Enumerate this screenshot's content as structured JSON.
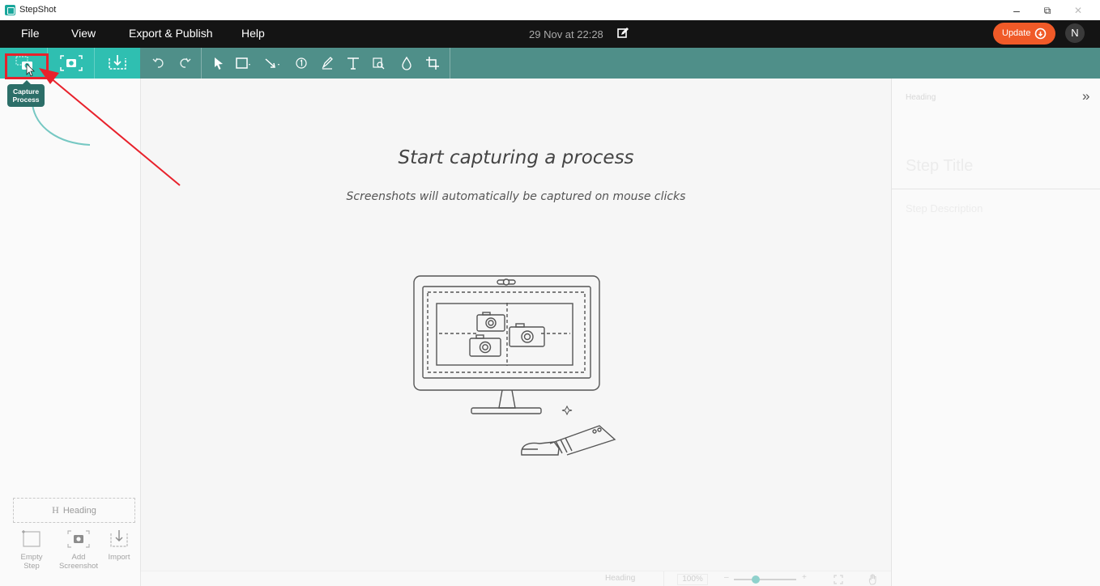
{
  "window": {
    "app_name": "StepShot",
    "controls": {
      "minimize": "–",
      "restore": "⧉",
      "close": "✕"
    }
  },
  "menu": {
    "items": [
      "File",
      "View",
      "Export & Publish",
      "Help"
    ],
    "document_date": "29 Nov at 22:28",
    "update_label": "Update",
    "user_initial": "N"
  },
  "toolbar": {
    "capture_buttons": [
      "capture-process-icon",
      "add-screenshot-icon",
      "import-icon"
    ],
    "tools": [
      "undo-icon",
      "redo-icon",
      "select-icon",
      "rectangle-icon",
      "arrow-icon",
      "number-icon",
      "pen-icon",
      "text-icon",
      "magnify-icon",
      "blur-icon",
      "crop-icon"
    ]
  },
  "tooltip": {
    "line1": "Capture",
    "line2": "Process"
  },
  "left_panel": {
    "heading_glyph": "H",
    "heading_label": "Heading",
    "empty_step": {
      "line1": "Empty",
      "line2": "Step"
    },
    "add_screenshot": {
      "line1": "Add",
      "line2": "Screenshot"
    },
    "import": {
      "line1": "Import"
    }
  },
  "canvas": {
    "title": "Start capturing a process",
    "subtitle": "Screenshots will automatically be captured on mouse clicks"
  },
  "status": {
    "heading": "Heading",
    "zoom": "100%",
    "zoom_out": "–",
    "zoom_in": "+",
    "zoom_level": 0.35
  },
  "right_panel": {
    "heading_label": "Heading",
    "collapse_glyph": "»",
    "step_title_placeholder": "Step Title",
    "step_description_placeholder": "Step Description"
  },
  "colors": {
    "menubar": "#141414",
    "toolbar": "#4f8f89",
    "capture_group": "#2fbfb1",
    "update_button": "#f05a28",
    "annotation_red": "#e8212b"
  }
}
